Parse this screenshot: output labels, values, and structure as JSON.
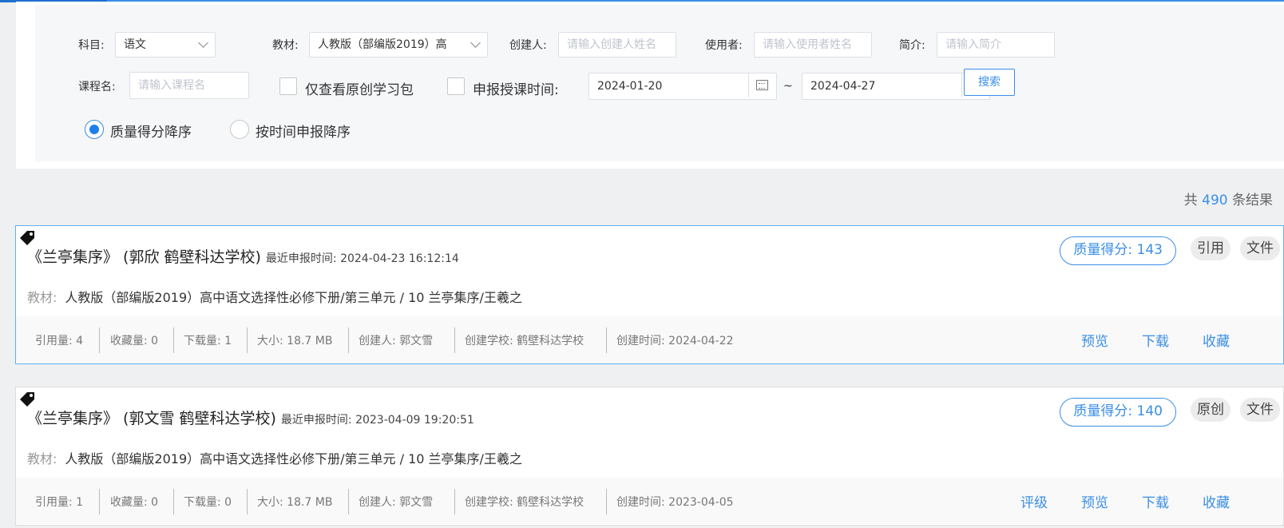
{
  "filters": {
    "subject_label": "科目:",
    "subject_value": "语文",
    "textbook_label": "教材:",
    "textbook_value": "人教版（部编版2019）高",
    "creator_label": "创建人:",
    "creator_placeholder": "请输入创建人姓名",
    "user_label": "使用者:",
    "user_placeholder": "请输入使用者姓名",
    "intro_label": "简介:",
    "intro_placeholder": "请输入简介",
    "course_label": "课程名:",
    "course_placeholder": "请输入课程名",
    "original_only": "仅查看原创学习包",
    "report_time_label": "申报授课时间:",
    "date_start": "2024-01-20",
    "date_sep": "~",
    "date_end": "2024-04-27",
    "search_button": "搜索",
    "sort_quality": "质量得分降序",
    "sort_time": "按时间申报降序"
  },
  "results": {
    "prefix": "共",
    "count": "490",
    "suffix": "条结果"
  },
  "cards": [
    {
      "title": "《兰亭集序》 (郭欣 鹤壁科达学校)",
      "report_time": "最近申报时间: 2024-04-23 16:12:14",
      "quality": "质量得分: 143",
      "tag": "引用",
      "file": "文件",
      "material_label": "教材:",
      "material": "人教版（部编版2019）高中语文选择性必修下册/第三单元 / 10 兰亭集序/王羲之",
      "stats": [
        "引用量: 4",
        "收藏量: 0",
        "下载量: 1",
        "大小: 18.7 MB",
        "创建人:  郭文雪",
        "创建学校:  鹤壁科达学校",
        "创建时间:  2024-04-22"
      ],
      "actions": [
        "预览",
        "下载",
        "收藏"
      ]
    },
    {
      "title": "《兰亭集序》 (郭文雪 鹤壁科达学校)",
      "report_time": "最近申报时间: 2023-04-09 19:20:51",
      "quality": "质量得分: 140",
      "tag": "原创",
      "file": "文件",
      "material_label": "教材:",
      "material": "人教版（部编版2019）高中语文选择性必修下册/第三单元 / 10 兰亭集序/王羲之",
      "stats": [
        "引用量: 1",
        "收藏量: 0",
        "下载量: 0",
        "大小: 18.7 MB",
        "创建人:  郭文雪",
        "创建学校:  鹤壁科达学校",
        "创建时间:  2023-04-05"
      ],
      "actions": [
        "评级",
        "预览",
        "下载",
        "收藏"
      ]
    }
  ],
  "colors": {
    "accent": "#3a8ee6",
    "radio_on": "#1e7fe8"
  },
  "icons": {
    "tag": "tag-icon",
    "calendar": "calendar-icon",
    "dropdown": "chevron-down-icon"
  }
}
